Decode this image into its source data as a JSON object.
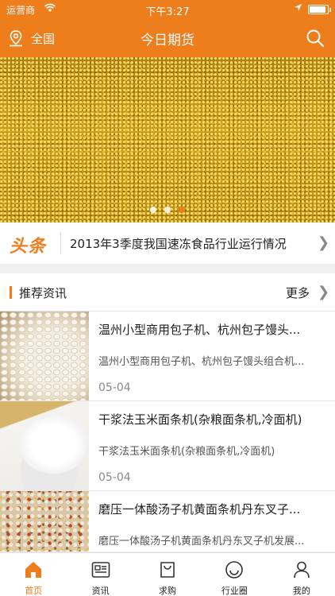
{
  "status_bar": {
    "carrier": "运营商",
    "time": "下午3:27"
  },
  "header": {
    "location": "全国",
    "title": "今日期货"
  },
  "headline": {
    "tag": "头条",
    "text": "2013年3季度我国速冻食品行业运行情况"
  },
  "section": {
    "title": "推荐资讯",
    "more": "更多"
  },
  "news": [
    {
      "title": "温州小型商用包子机、杭州包子馒头...",
      "desc": "温州小型商用包子机、杭州包子馒头组合机...",
      "date": "05-04"
    },
    {
      "title": "干浆法玉米面条机(杂粮面条机,冷面机)",
      "desc": "干浆法玉米面条机(杂粮面条机,冷面机)",
      "date": "05-04"
    },
    {
      "title": "磨压一体酸汤子机黄面条机丹东叉子...",
      "desc": "磨压一体酸汤子机黄面条机丹东叉子机发展...",
      "date": ""
    }
  ],
  "tabs": [
    {
      "label": "首页",
      "icon": "home-icon"
    },
    {
      "label": "资讯",
      "icon": "news-icon"
    },
    {
      "label": "求购",
      "icon": "bag-icon"
    },
    {
      "label": "行业圈",
      "icon": "smile-icon"
    },
    {
      "label": "我的",
      "icon": "person-icon"
    }
  ],
  "colors": {
    "accent": "#ee7d1c"
  }
}
